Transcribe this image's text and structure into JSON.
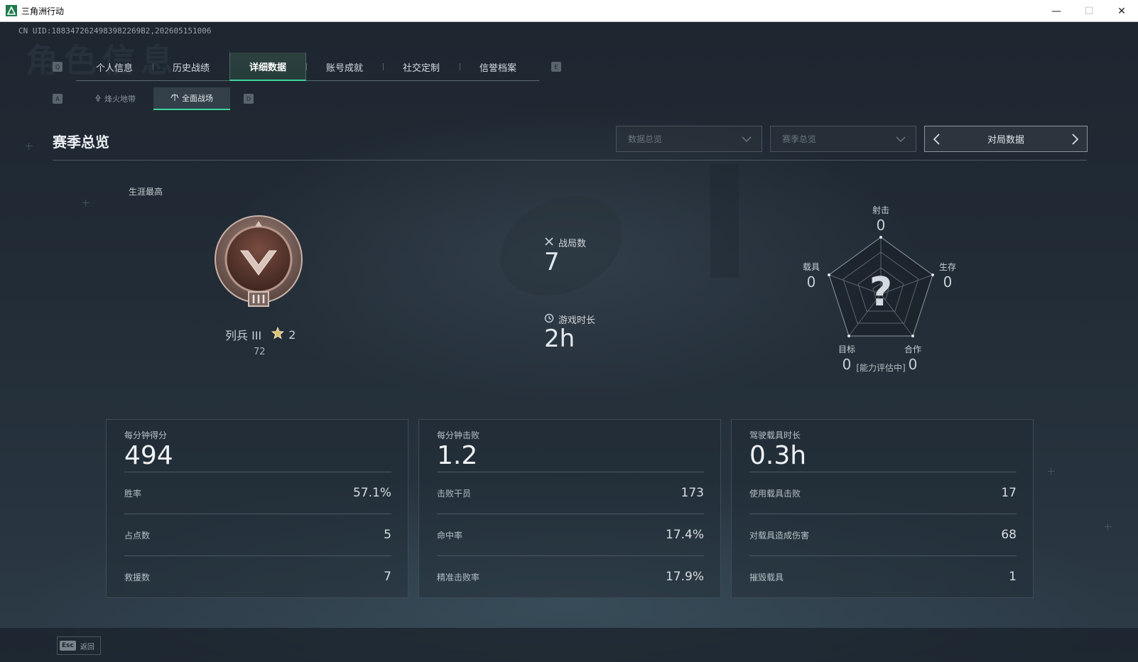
{
  "window": {
    "title": "三角洲行动",
    "minimize": "—",
    "maximize": "☐",
    "close": "✕"
  },
  "uid": "CN UID:1883472624983982269B2,202605151006",
  "watermark": "角色信息",
  "tabs": {
    "prev_key": "Q",
    "next_key": "E",
    "items": [
      {
        "label": "个人信息"
      },
      {
        "label": "历史战绩"
      },
      {
        "label": "详细数据",
        "active": true
      },
      {
        "label": "账号成就"
      },
      {
        "label": "社交定制"
      },
      {
        "label": "信誉档案"
      }
    ]
  },
  "subtabs": {
    "prev_key": "A",
    "next_key": "D",
    "items": [
      {
        "label": "烽火地带",
        "icon": "fire-zone-icon"
      },
      {
        "label": "全面战场",
        "icon": "battlefield-icon",
        "active": true
      }
    ]
  },
  "header": {
    "title": "赛季总览",
    "dropdown1": "数据总览",
    "dropdown2": "赛季总览",
    "pager_label": "对局数据"
  },
  "rank": {
    "career_label": "生涯最高",
    "name": "列兵 III",
    "stars": "2",
    "points": "72"
  },
  "middle": {
    "matches_label": "战局数",
    "matches_value": "7",
    "playtime_label": "游戏时长",
    "playtime_value": "2h"
  },
  "radar": {
    "axes": [
      {
        "label": "射击",
        "value": "0"
      },
      {
        "label": "生存",
        "value": "0"
      },
      {
        "label": "合作",
        "value": "0"
      },
      {
        "label": "目标",
        "value": "0"
      },
      {
        "label": "载具",
        "value": "0"
      }
    ],
    "center": "?",
    "note": "[能力评估中]"
  },
  "cards": [
    {
      "label": "每分钟得分",
      "value": "494",
      "rows": [
        {
          "label": "胜率",
          "value": "57.1%"
        },
        {
          "label": "占点数",
          "value": "5"
        },
        {
          "label": "救援数",
          "value": "7"
        }
      ]
    },
    {
      "label": "每分钟击败",
      "value": "1.2",
      "rows": [
        {
          "label": "击败干员",
          "value": "173"
        },
        {
          "label": "命中率",
          "value": "17.4%"
        },
        {
          "label": "精准击败率",
          "value": "17.9%"
        }
      ]
    },
    {
      "label": "驾驶载具时长",
      "value": "0.3h",
      "rows": [
        {
          "label": "使用载具击败",
          "value": "17"
        },
        {
          "label": "对载具造成伤害",
          "value": "68"
        },
        {
          "label": "摧毁载具",
          "value": "1"
        }
      ]
    }
  ],
  "footer": {
    "esc_key": "Esc",
    "back_label": "返回"
  },
  "colors": {
    "accent": "#3ed59a",
    "background": "#1a222c"
  }
}
